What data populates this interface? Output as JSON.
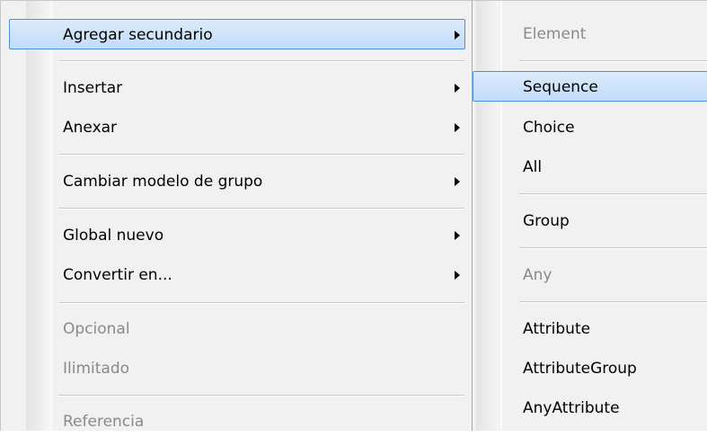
{
  "main_menu": {
    "items": [
      {
        "label": "Agregar secundario",
        "has_submenu": true,
        "state": "highlighted"
      },
      {
        "label": "Insertar",
        "has_submenu": true,
        "state": "enabled"
      },
      {
        "label": "Anexar",
        "has_submenu": true,
        "state": "enabled"
      },
      {
        "label": "Cambiar modelo de grupo",
        "has_submenu": true,
        "state": "enabled"
      },
      {
        "label": "Global nuevo",
        "has_submenu": true,
        "state": "enabled"
      },
      {
        "label": "Convertir en...",
        "has_submenu": true,
        "state": "enabled"
      },
      {
        "label": "Opcional",
        "has_submenu": false,
        "state": "disabled"
      },
      {
        "label": "Ilimitado",
        "has_submenu": false,
        "state": "disabled"
      },
      {
        "label": "Referencia",
        "has_submenu": false,
        "state": "disabled"
      }
    ]
  },
  "sub_menu": {
    "items": [
      {
        "label": "Element",
        "state": "disabled"
      },
      {
        "label": "Sequence",
        "state": "highlighted"
      },
      {
        "label": "Choice",
        "state": "enabled"
      },
      {
        "label": "All",
        "state": "enabled"
      },
      {
        "label": "Group",
        "state": "enabled"
      },
      {
        "label": "Any",
        "state": "disabled"
      },
      {
        "label": "Attribute",
        "state": "enabled"
      },
      {
        "label": "AttributeGroup",
        "state": "enabled"
      },
      {
        "label": "AnyAttribute",
        "state": "enabled"
      }
    ]
  },
  "colors": {
    "menu_background": "#f1f1f1",
    "highlight_fill": "#c9e0fa",
    "highlight_border": "#4e8fe0",
    "disabled_text": "#8a8a8a"
  }
}
